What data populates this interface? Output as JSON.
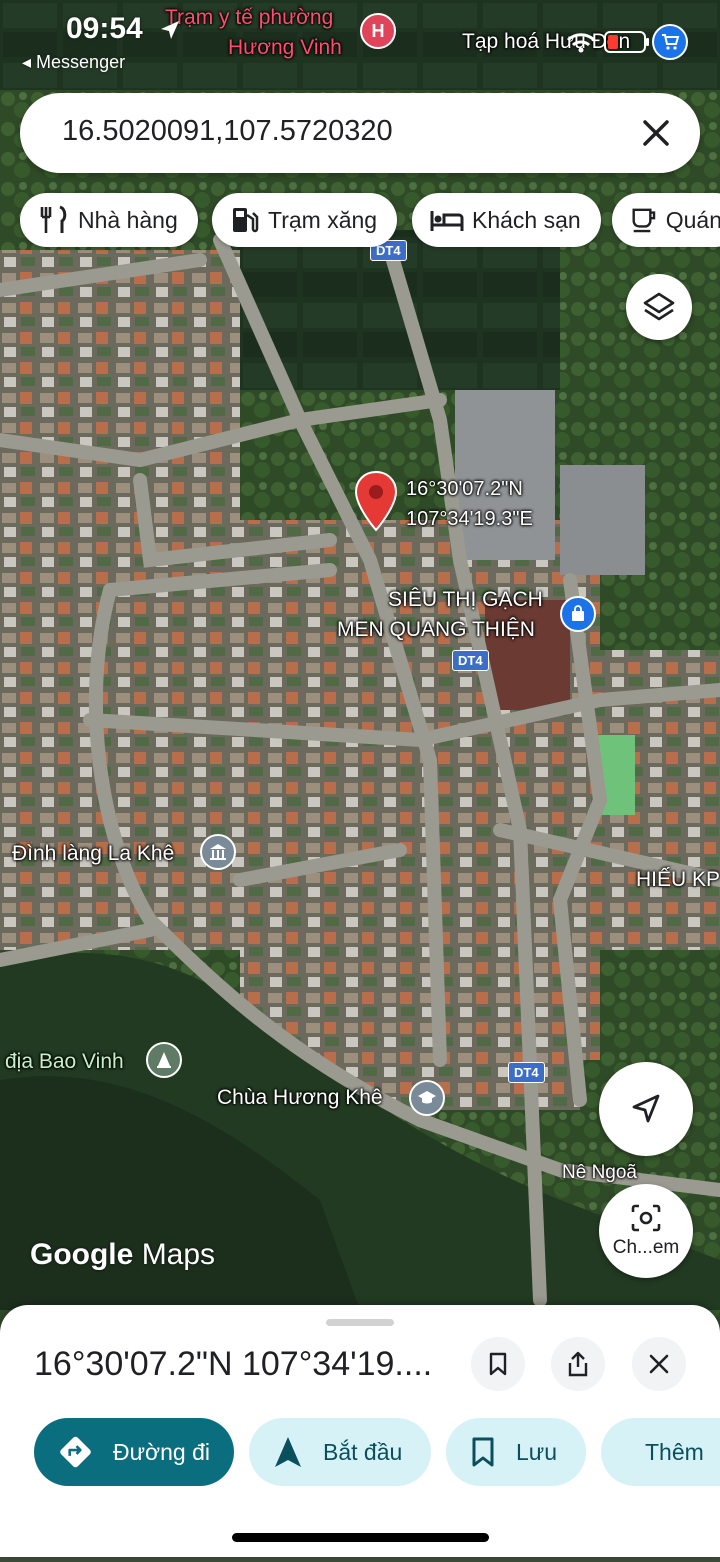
{
  "status_bar": {
    "time": "09:54",
    "back_app": "◂ Messenger"
  },
  "search": {
    "query": "16.5020091,107.5720320"
  },
  "chips": [
    {
      "label": "Nhà hàng",
      "icon": "restaurant-icon"
    },
    {
      "label": "Trạm xăng",
      "icon": "gas-station-icon"
    },
    {
      "label": "Khách sạn",
      "icon": "hotel-icon"
    },
    {
      "label": "Quán",
      "icon": "cafe-icon"
    }
  ],
  "map": {
    "labels": {
      "health_station": "Trạm y tế phường",
      "health_station_line2": "Hương Vinh",
      "grocery": "Tạp hoá Hưu Đen",
      "pin_lat": "16°30'07.2\"N",
      "pin_lng": "107°34'19.3\"E",
      "tile_store": "SIÊU THỊ GẠCH",
      "tile_store_line2": "MEN QUANG THIỆN",
      "village_hall": "Đình làng La Khê",
      "cemetery": "địa Bao Vinh",
      "pagoda": "Chùa Hương Khê",
      "hieu": "HIẾU KP",
      "ne_ngoa": "Nê Ngoã"
    },
    "road_shields": [
      "DT4",
      "DT4",
      "DT4"
    ],
    "google_logo_a": "Google",
    "google_logo_b": "Maps",
    "lens_label": "Ch...em"
  },
  "sheet": {
    "title": "16°30'07.2\"N 107°34'19....",
    "actions": [
      {
        "label": "Đường đi",
        "icon": "directions-icon"
      },
      {
        "label": "Bắt đầu",
        "icon": "navigation-arrow-icon"
      },
      {
        "label": "Lưu",
        "icon": "bookmark-icon"
      },
      {
        "label": "Thêm",
        "icon": "flag-icon"
      }
    ]
  },
  "colors": {
    "accent": "#0b6e7f",
    "secondary_bg": "#d7f2f7",
    "pin": "#e53935"
  }
}
